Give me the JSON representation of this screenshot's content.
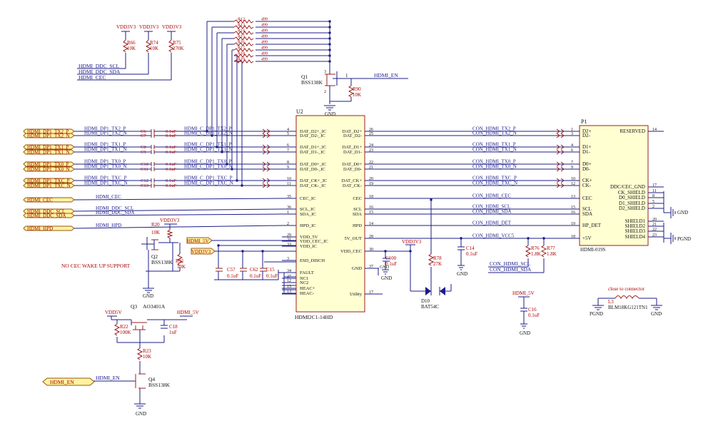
{
  "schematic": {
    "u2": {
      "ref": "U2",
      "part": "HDMI2C1-14HD",
      "left_pins": [
        {
          "num": "4",
          "name": "DAT_D2+_IC"
        },
        {
          "num": "5",
          "name": "DAT_D2-_IC"
        },
        {
          "num": "6",
          "name": "DAT_D1+_IC"
        },
        {
          "num": "7",
          "name": "DAT_D1-_IC"
        },
        {
          "num": "8",
          "name": "DAT_D0+_IC"
        },
        {
          "num": "9",
          "name": "DAT_D0-_IC"
        },
        {
          "num": "10",
          "name": "DAT_CK+_IC"
        },
        {
          "num": "11",
          "name": "DAT_CK-_IC"
        },
        {
          "num": "35",
          "name": "CEC_IC"
        },
        {
          "num": "36",
          "name": "SCL_IC"
        },
        {
          "num": "1",
          "name": "SDA_IC"
        },
        {
          "num": "2",
          "name": "HPD_IC"
        },
        {
          "num": "29",
          "name": "VDD_5V"
        },
        {
          "num": "31",
          "name": "VDD_CEC_IC"
        },
        {
          "num": "33",
          "name": "VDD_IC"
        },
        {
          "num": "3",
          "name": "ESD_DISCH"
        },
        {
          "num": "34",
          "name": "FAULT"
        },
        {
          "num": "27",
          "name": "NC1"
        },
        {
          "num": "12",
          "name": "NC2"
        },
        {
          "num": "13",
          "name": "HEAC+"
        },
        {
          "num": "13",
          "name": "HEAC-"
        }
      ],
      "right_pins": [
        {
          "num": "26",
          "name": "DAT_D2+"
        },
        {
          "num": "25",
          "name": "DAT_D2-"
        },
        {
          "num": "24",
          "name": "DAT_D1+"
        },
        {
          "num": "23",
          "name": "DAT_D1-"
        },
        {
          "num": "22",
          "name": "DAT_D0+"
        },
        {
          "num": "21",
          "name": "DAT_D0-"
        },
        {
          "num": "20",
          "name": "DAT_CK+"
        },
        {
          "num": "19",
          "name": "DAT_CK-"
        },
        {
          "num": "18",
          "name": "CEC"
        },
        {
          "num": "16",
          "name": "SCL"
        },
        {
          "num": "15",
          "name": "SDA"
        },
        {
          "num": "14",
          "name": "HPD"
        },
        {
          "num": "28",
          "name": "5V_OUT"
        },
        {
          "num": "30",
          "name": "VDD_CEC"
        },
        {
          "num": "37",
          "name": "GND"
        },
        {
          "num": "17",
          "name": "Utility"
        }
      ]
    },
    "p1": {
      "ref": "P1",
      "part": "HDMI-019S",
      "left_pins": [
        {
          "num": "1",
          "name": "D2+"
        },
        {
          "num": "3",
          "name": "D2-"
        },
        {
          "num": "4",
          "name": "D1+"
        },
        {
          "num": "6",
          "name": "D1-"
        },
        {
          "num": "7",
          "name": "D0+"
        },
        {
          "num": "9",
          "name": "D0-"
        },
        {
          "num": "10",
          "name": "CK+"
        },
        {
          "num": "12",
          "name": "CK-"
        },
        {
          "num": "13",
          "name": "CEC"
        },
        {
          "num": "15",
          "name": "SCL"
        },
        {
          "num": "16",
          "name": "SDA"
        },
        {
          "num": "19",
          "name": "HP_DET"
        },
        {
          "num": "18",
          "name": "+5V"
        }
      ],
      "right_pins": [
        {
          "num": "14",
          "name": "RESERVED"
        },
        {
          "num": "17",
          "name": "DDC/CEC_GND"
        },
        {
          "num": "11",
          "name": "CK_SHIELD"
        },
        {
          "num": "8",
          "name": "D0_SHIELD"
        },
        {
          "num": "5",
          "name": "D1_SHIELD"
        },
        {
          "num": "2",
          "name": "D2_SHIELD"
        },
        {
          "num": "20",
          "name": "SHIELD1"
        },
        {
          "num": "21",
          "name": "SHIELD2"
        },
        {
          "num": "22",
          "name": "SHIELD3"
        },
        {
          "num": "23",
          "name": "SHIELD4"
        }
      ]
    },
    "input_ports": [
      "HDMI_DP1_TX2_P",
      "HDMI_DP1_TX2_N",
      "HDMI_DP1_TX1_P",
      "HDMI_DP1_TX1_N",
      "HDMI_DP1_TX0_P",
      "HDMI_DP1_TX0_N",
      "HDMI_DP1_TXC_P",
      "HDMI_DP1_TXC_N",
      "HDMI_CEC",
      "HDMI_DDC_SCL",
      "HDMI_DDC_SDA",
      "HDMI_HPD"
    ],
    "left_nets": [
      "HDMI_DP1_TX2_P",
      "HDMI_DP1_TX2_N",
      "HDMI_DP1_TX1_P",
      "HDMI_DP1_TX1_N",
      "HDMI_DP1_TX0_P",
      "HDMI_DP1_TX0_N",
      "HDMI_DP1_TXC_P",
      "HDMI_DP1_TXC_N",
      "HDMI_CEC",
      "HDMI_DDC_SCL",
      "HDMI_DDC_SDA",
      "HDMI_HPD"
    ],
    "caps_series": [
      {
        "ref": "C6",
        "val": "0.1uF",
        "net": "HDMI_C_DP1_TX2_P"
      },
      {
        "ref": "C7",
        "val": "0.1uF",
        "net": "HDMI_C_DP1_TX2_N"
      },
      {
        "ref": "C8",
        "val": "0.1uF",
        "net": "HDMI_C_DP1_TX1_P"
      },
      {
        "ref": "C9",
        "val": "0.1uF",
        "net": "HDMI_C_DP1_TX1_N"
      },
      {
        "ref": "C10",
        "val": "0.1uF",
        "net": "HDMI_C_DP1_TX0_P"
      },
      {
        "ref": "C11",
        "val": "0.1uF",
        "net": "HDMI_C_DP1_TX0_N"
      },
      {
        "ref": "C12",
        "val": "0.1uF",
        "net": "HDMI_C_DP1_TXC_P"
      },
      {
        "ref": "C13",
        "val": "0.1uF",
        "net": "HDMI_C_DP1_TXC_N"
      }
    ],
    "right_nets": [
      "CON_HDMI_TX2_P",
      "CON_HDMI_TX2_N",
      "CON_HDMI_TX1_P",
      "CON_HDMI_TX1_N",
      "CON_HDMI_TX0_P",
      "CON_HDMI_TX0_N",
      "CON_HDMI_TXC_P",
      "CON_HDMI_TXC_N",
      "CON_HDMI_CEC",
      "CON_HDMI_SCL",
      "CON_HDMI_SDA",
      "CON_HDMI_DET",
      "CON_HDMI_VCC5"
    ],
    "pullups": [
      {
        "ref": "R66",
        "val": "10K",
        "rail": "VDD3V3"
      },
      {
        "ref": "R74",
        "val": "10K",
        "rail": "VDD3V3"
      },
      {
        "ref": "R75",
        "val": "270K",
        "rail": "VDD3V3"
      }
    ],
    "top_ddc_nets": [
      "HDMI_DDC_SCL",
      "HDMI_DDC_SDA",
      "HDMI_CEC"
    ],
    "pulldowns": [
      {
        "ref": "R12",
        "val": "499"
      },
      {
        "ref": "R13",
        "val": "499"
      },
      {
        "ref": "R14",
        "val": "499"
      },
      {
        "ref": "R15",
        "val": "499"
      },
      {
        "ref": "R16",
        "val": "499"
      },
      {
        "ref": "R17",
        "val": "499"
      },
      {
        "ref": "R18",
        "val": "499"
      },
      {
        "ref": "R19",
        "val": "499"
      }
    ],
    "q1": {
      "ref": "Q1",
      "part": "BSS138K",
      "pin1": "1",
      "pin2": "2",
      "pin3": "3"
    },
    "r90": {
      "ref": "R90",
      "val": "10K"
    },
    "hdmi_en": "HDMI_EN",
    "gnd": "GND",
    "pgnd": "PGND",
    "hpd_block": {
      "rail": "VDD3V3",
      "r20": "R20",
      "r20v": "10K",
      "q2": "Q2",
      "q2part": "BSS138K",
      "r91": "R91",
      "r91v": "10K",
      "note": "NO CEC WAKE UP SUPPORT"
    },
    "power_block": {
      "hdmi5v": "HDMI_5V",
      "vdd3v3": "VDD3V3",
      "c57": "C57",
      "c62": "C62",
      "c15": "C15",
      "cval": "0.1uF"
    },
    "cec_block": {
      "rail": "VDD3V3",
      "c100": "C100",
      "c100v": "0.1uF",
      "r78": "R78",
      "r78v": "27K",
      "d10": "D10",
      "d10p": "BAT54C"
    },
    "c14": {
      "ref": "C14",
      "val": "0.1uF"
    },
    "r76": {
      "ref": "R76",
      "val": "1.8K"
    },
    "r77": {
      "ref": "R77",
      "val": "1.8K"
    },
    "con_ddc": [
      "CON_HDMI_SCL",
      "CON_HDMI_SDA"
    ],
    "hdmi5v_cap": {
      "net": "HDMI_5V",
      "ref": "C16",
      "val": "0.1uF"
    },
    "bead": {
      "note": "close to connector",
      "ref": "L3",
      "part": "BLM18KG121TN1",
      "left": "PGND",
      "right": "GND"
    },
    "q3_block": {
      "ref": "Q3",
      "part": "AO3401A",
      "vdd5v": "VDD5V",
      "out": "HDMI_5V",
      "r22": "R22",
      "r22v": "100K",
      "c18": "C18",
      "c18v": "1nF",
      "r23": "R23",
      "r23v": "10K",
      "q4": "Q4",
      "q4part": "BSS138K",
      "en": "HDMI_EN"
    }
  }
}
